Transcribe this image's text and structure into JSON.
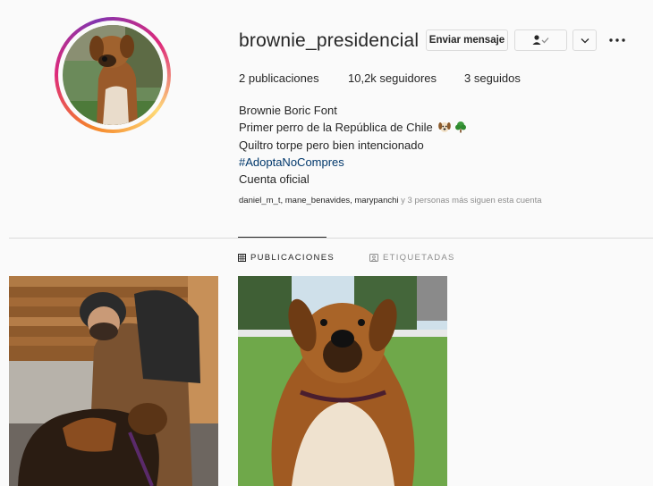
{
  "profile": {
    "username": "brownie_presidencial",
    "send_message_label": "Enviar mensaje",
    "following_icon": "person-check-icon",
    "more_icon": "ellipsis-icon"
  },
  "stats": {
    "posts": "2 publicaciones",
    "followers": "10,2k seguidores",
    "following": "3 seguidos"
  },
  "bio": {
    "name": "Brownie Boric Font",
    "line1": "Primer perro de la República de Chile",
    "line1_emojis": [
      "dog-face-icon",
      "tree-icon"
    ],
    "line2": "Quiltro torpe pero bien intencionado",
    "hashtag": "#AdoptaNoCompres",
    "line4": "Cuenta oficial"
  },
  "followed_by": {
    "users": "daniel_m_t, mane_benavides, marypanchi",
    "suffix": " y 3 personas más siguen esta cuenta"
  },
  "tabs": [
    {
      "label": "PUBLICACIONES",
      "icon": "grid-icon",
      "active": true
    },
    {
      "label": "ETIQUETADAS",
      "icon": "tag-person-icon",
      "active": false
    }
  ],
  "posts": [
    {
      "icon": "photo-man-with-dog"
    },
    {
      "icon": "photo-dog-portrait"
    }
  ],
  "colors": {
    "hashtag": "#00376b",
    "muted": "#8e8e8e",
    "border": "#dbdbdb",
    "background": "#fafafa"
  }
}
